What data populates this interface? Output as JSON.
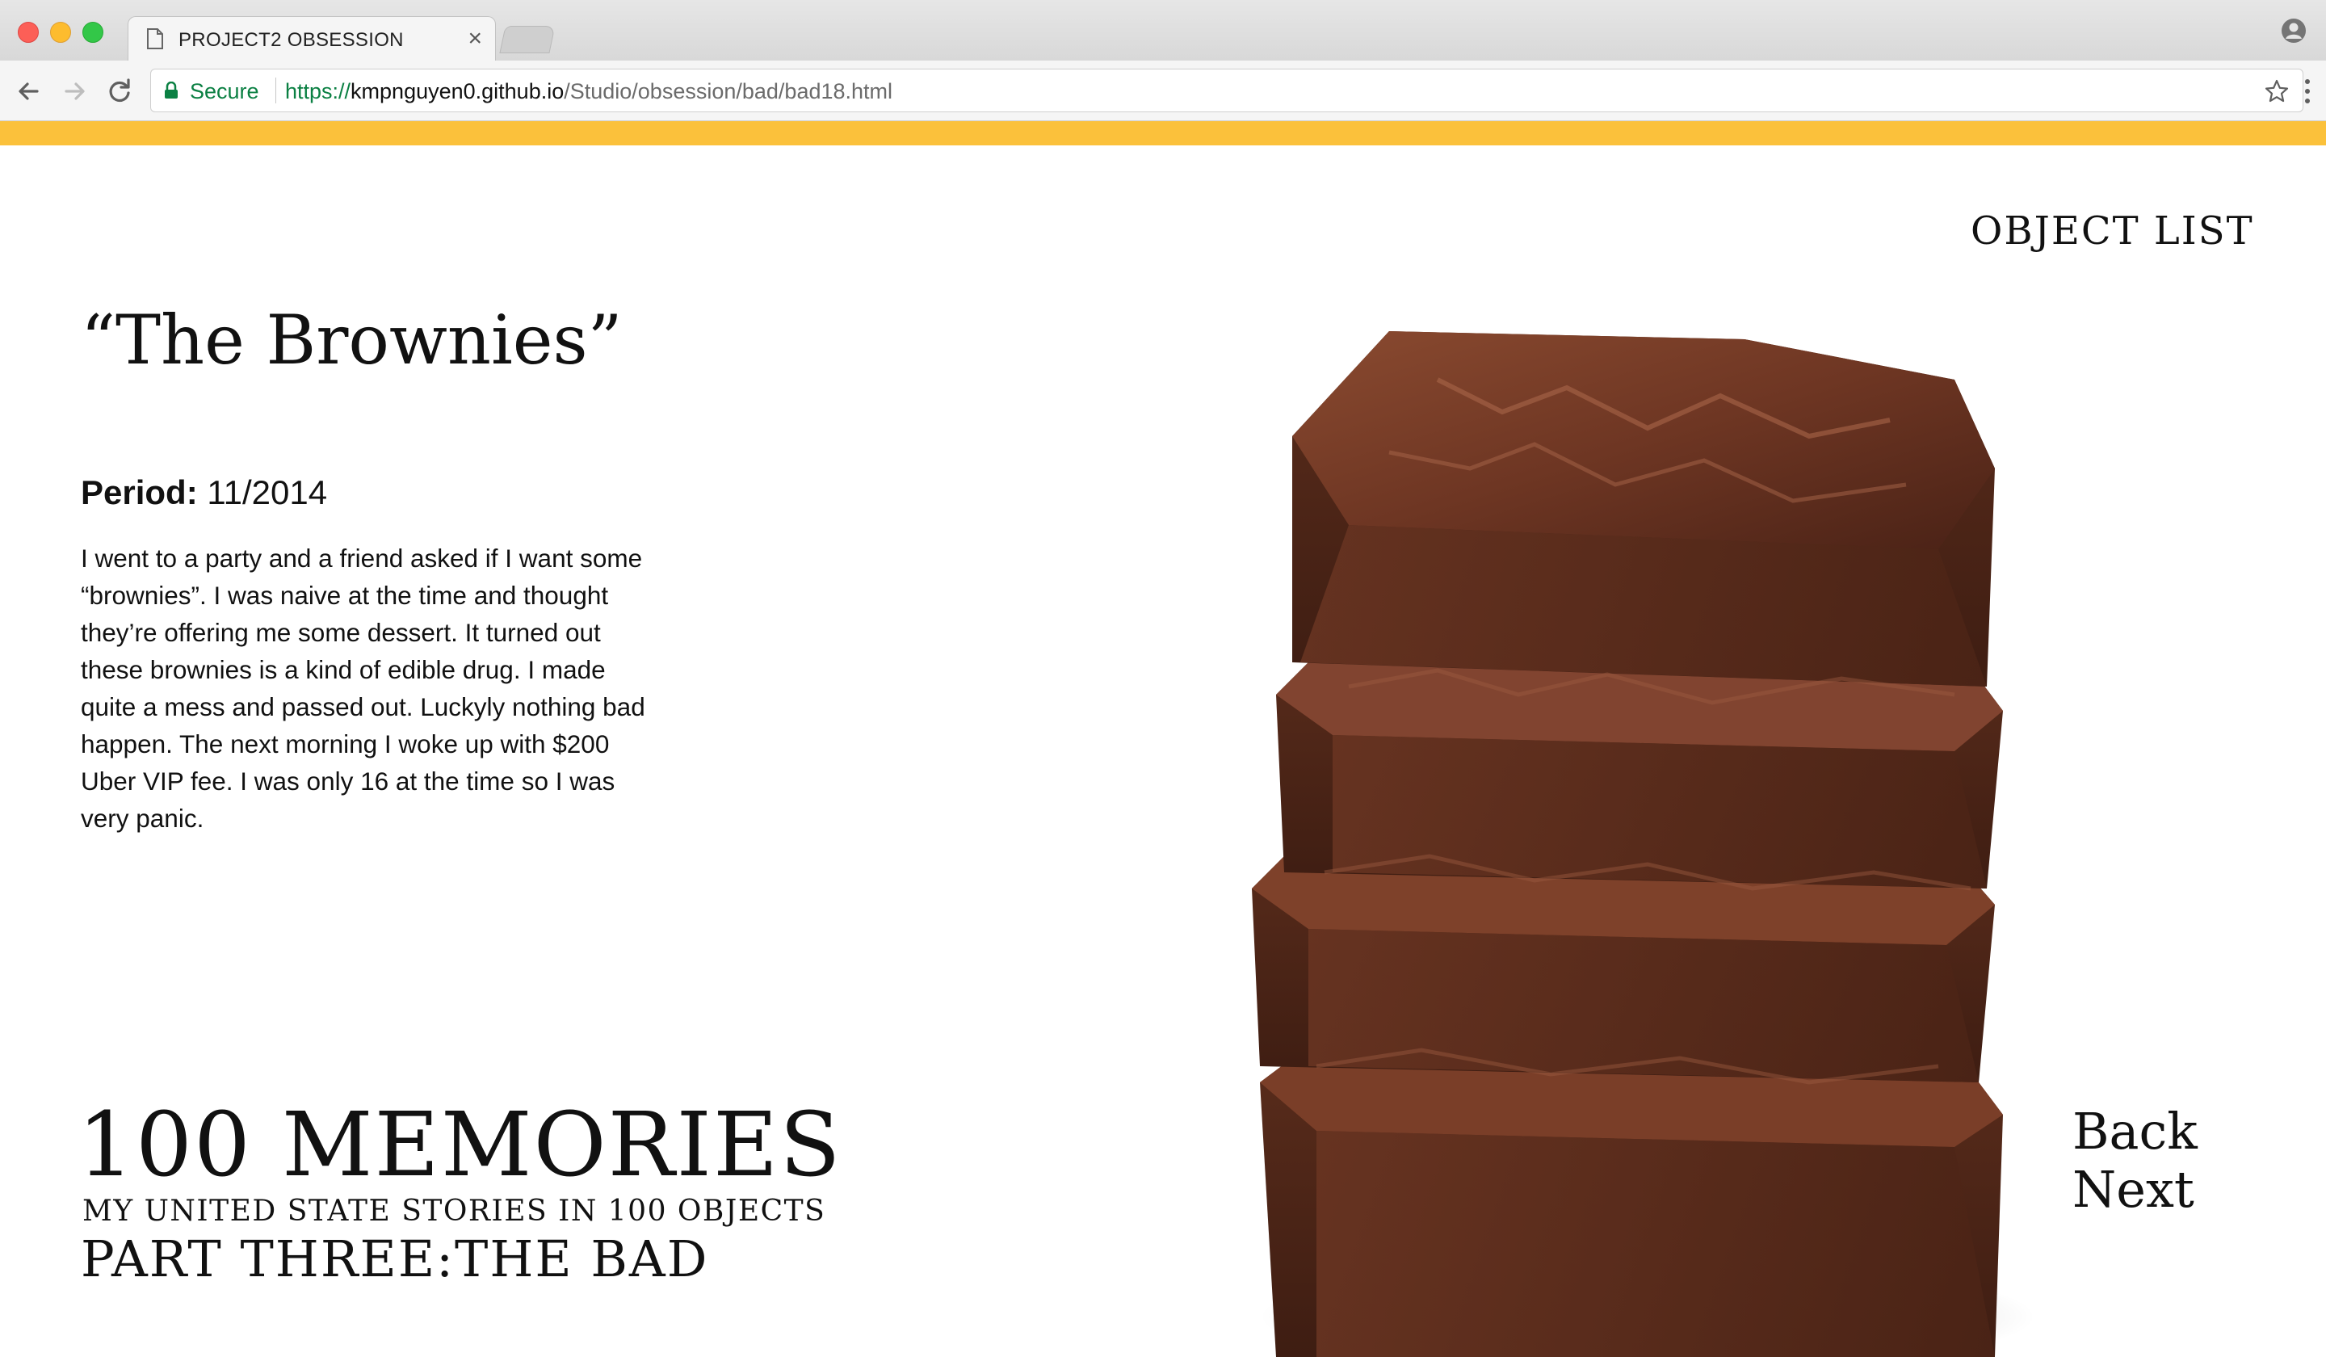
{
  "browser": {
    "tab_title": "PROJECT2 OBSESSION",
    "secure_label": "Secure",
    "url_scheme": "https://",
    "url_host": "kmpnguyen0.github.io",
    "url_path": "/Studio/obsession/bad/bad18.html",
    "accent_color": "#fbc13b"
  },
  "nav": {
    "object_list": "OBJECT LIST",
    "back": "Back",
    "next": "Next"
  },
  "object": {
    "title": "“The Brownies”",
    "period_label": "Period:",
    "period_value": "11/2014",
    "story": "I went to a party and a friend asked if I want some “brownies”. I was naive at the time and thought they’re offering me some dessert. It turned out these brownies is a kind of edible drug. I made quite a mess and passed out. Luckyly nothing bad happen. The next morning I woke up with $200 Uber VIP fee. I was only 16 at the time so I was very panic."
  },
  "branding": {
    "main": "100 MEMORIES",
    "sub": "MY UNITED STATE STORIES IN 100 OBJECTS",
    "part": "PART THREE:THE BAD"
  },
  "icons": {
    "tab": "page-icon",
    "back": "arrow-left-icon",
    "forward": "arrow-right-icon",
    "reload": "reload-icon",
    "lock": "lock-icon",
    "bookmark": "star-icon",
    "menu": "kebab-menu-icon",
    "profile": "profile-icon"
  }
}
